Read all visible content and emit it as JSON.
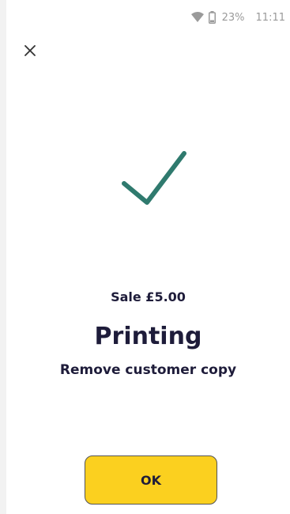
{
  "status_bar": {
    "wifi_icon": "wifi-icon",
    "battery_icon": "battery-icon",
    "battery_percent": "23%",
    "time": "11:11"
  },
  "header": {
    "close_icon": "close-icon"
  },
  "result": {
    "success_icon": "check-mark-icon",
    "sale_text": "Sale £5.00",
    "status_title": "Printing",
    "instruction": "Remove customer copy"
  },
  "actions": {
    "ok_label": "OK"
  },
  "colors": {
    "accent": "#2f7a6e",
    "button": "#fbd01f",
    "text": "#1e1c3a"
  }
}
